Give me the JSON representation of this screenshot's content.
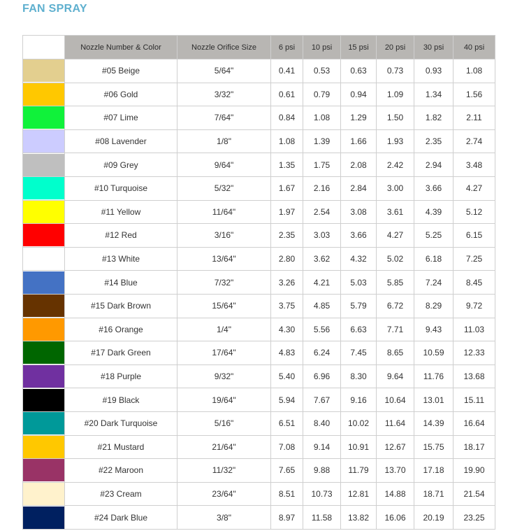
{
  "title": "FAN SPRAY",
  "table": {
    "headers": [
      "",
      "Nozzle Number & Color",
      "Nozzle Orifice Size",
      "6 psi",
      "10 psi",
      "15 psi",
      "20 psi",
      "30 psi",
      "40 psi"
    ],
    "rows": [
      {
        "color": "#e3cf8f",
        "name": "#05 Beige",
        "size": "5/64\"",
        "values": [
          "0.41",
          "0.53",
          "0.63",
          "0.73",
          "0.93",
          "1.08"
        ]
      },
      {
        "color": "#ffc800",
        "name": "#06 Gold",
        "size": "3/32\"",
        "values": [
          "0.61",
          "0.79",
          "0.94",
          "1.09",
          "1.34",
          "1.56"
        ]
      },
      {
        "color": "#10f23a",
        "name": "#07 Lime",
        "size": "7/64\"",
        "values": [
          "0.84",
          "1.08",
          "1.29",
          "1.50",
          "1.82",
          "2.11"
        ]
      },
      {
        "color": "#ccccff",
        "name": "#08 Lavender",
        "size": "1/8\"",
        "values": [
          "1.08",
          "1.39",
          "1.66",
          "1.93",
          "2.35",
          "2.74"
        ]
      },
      {
        "color": "#bfbfbf",
        "name": "#09 Grey",
        "size": "9/64\"",
        "values": [
          "1.35",
          "1.75",
          "2.08",
          "2.42",
          "2.94",
          "3.48"
        ]
      },
      {
        "color": "#00ffcc",
        "name": "#10 Turquoise",
        "size": "5/32\"",
        "values": [
          "1.67",
          "2.16",
          "2.84",
          "3.00",
          "3.66",
          "4.27"
        ]
      },
      {
        "color": "#ffff00",
        "name": "#11 Yellow",
        "size": "11/64\"",
        "values": [
          "1.97",
          "2.54",
          "3.08",
          "3.61",
          "4.39",
          "5.12"
        ]
      },
      {
        "color": "#ff0000",
        "name": "#12 Red",
        "size": "3/16\"",
        "values": [
          "2.35",
          "3.03",
          "3.66",
          "4.27",
          "5.25",
          "6.15"
        ]
      },
      {
        "color": "#ffffff",
        "name": "#13 White",
        "size": "13/64\"",
        "values": [
          "2.80",
          "3.62",
          "4.32",
          "5.02",
          "6.18",
          "7.25"
        ]
      },
      {
        "color": "#4472c4",
        "name": "#14 Blue",
        "size": "7/32\"",
        "values": [
          "3.26",
          "4.21",
          "5.03",
          "5.85",
          "7.24",
          "8.45"
        ]
      },
      {
        "color": "#663300",
        "name": "#15 Dark Brown",
        "size": "15/64\"",
        "values": [
          "3.75",
          "4.85",
          "5.79",
          "6.72",
          "8.29",
          "9.72"
        ]
      },
      {
        "color": "#ff9900",
        "name": "#16 Orange",
        "size": "1/4\"",
        "values": [
          "4.30",
          "5.56",
          "6.63",
          "7.71",
          "9.43",
          "11.03"
        ]
      },
      {
        "color": "#006600",
        "name": "#17 Dark Green",
        "size": "17/64\"",
        "values": [
          "4.83",
          "6.24",
          "7.45",
          "8.65",
          "10.59",
          "12.33"
        ]
      },
      {
        "color": "#7030a0",
        "name": "#18 Purple",
        "size": "9/32\"",
        "values": [
          "5.40",
          "6.96",
          "8.30",
          "9.64",
          "11.76",
          "13.68"
        ]
      },
      {
        "color": "#000000",
        "name": "#19 Black",
        "size": "19/64\"",
        "values": [
          "5.94",
          "7.67",
          "9.16",
          "10.64",
          "13.01",
          "15.11"
        ]
      },
      {
        "color": "#009999",
        "name": "#20 Dark Turquoise",
        "size": "5/16\"",
        "values": [
          "6.51",
          "8.40",
          "10.02",
          "11.64",
          "14.39",
          "16.64"
        ]
      },
      {
        "color": "#ffc800",
        "name": "#21 Mustard",
        "size": "21/64\"",
        "values": [
          "7.08",
          "9.14",
          "10.91",
          "12.67",
          "15.75",
          "18.17"
        ]
      },
      {
        "color": "#993366",
        "name": "#22 Maroon",
        "size": "11/32\"",
        "values": [
          "7.65",
          "9.88",
          "11.79",
          "13.70",
          "17.18",
          "19.90"
        ]
      },
      {
        "color": "#fff2cc",
        "name": "#23 Cream",
        "size": "23/64\"",
        "values": [
          "8.51",
          "10.73",
          "12.81",
          "14.88",
          "18.71",
          "21.54"
        ]
      },
      {
        "color": "#002060",
        "name": "#24 Dark Blue",
        "size": "3/8\"",
        "values": [
          "8.97",
          "11.58",
          "13.82",
          "16.06",
          "20.19",
          "23.25"
        ]
      }
    ]
  }
}
